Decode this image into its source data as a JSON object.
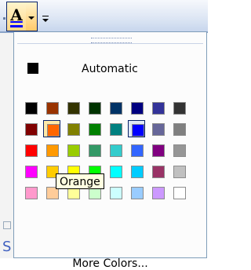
{
  "toolbar": {
    "font_color_glyph": "A"
  },
  "palette": {
    "automatic_label": "Automatic",
    "more_colors_label": "More Colors...",
    "tooltip_text": "Orange",
    "hovered": "Orange",
    "selected": "Blue",
    "rows": [
      [
        "#000000",
        "#993300",
        "#333300",
        "#003300",
        "#003366",
        "#000080",
        "#333399",
        "#333333"
      ],
      [
        "#800000",
        "#ff6600",
        "#808000",
        "#008000",
        "#008080",
        "#0000ff",
        "#666699",
        "#808080"
      ],
      [
        "#ff0000",
        "#ff9900",
        "#99cc00",
        "#339966",
        "#33cccc",
        "#3366ff",
        "#800080",
        "#969696"
      ],
      [
        "#ff00ff",
        "#ffcc00",
        "#ffff00",
        "#00ff00",
        "#00ffff",
        "#00ccff",
        "#993366",
        "#c0c0c0"
      ],
      [
        "#ff99cc",
        "#ffcc99",
        "#ffff99",
        "#ccffcc",
        "#ccffff",
        "#99ccff",
        "#cc99ff",
        "#ffffff"
      ]
    ]
  },
  "doc": {
    "partial_letter": "S"
  }
}
